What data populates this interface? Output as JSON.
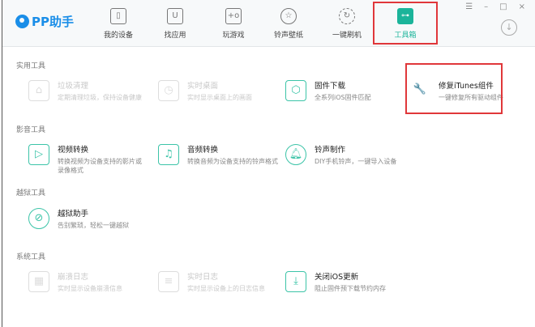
{
  "app": {
    "name": "PP助手"
  },
  "nav": [
    {
      "label": "我的设备",
      "icon": "phone-icon"
    },
    {
      "label": "找应用",
      "icon": "app-bag-icon"
    },
    {
      "label": "玩游戏",
      "icon": "gamepad-icon"
    },
    {
      "label": "铃声壁纸",
      "icon": "star-icon"
    },
    {
      "label": "一键刷机",
      "icon": "refresh-icon"
    },
    {
      "label": "工具箱",
      "icon": "toolbox-icon",
      "active": true
    }
  ],
  "window": {
    "menu": "☰",
    "minimize": "–",
    "maximize": "□",
    "close": "×",
    "download": "↓"
  },
  "sections": {
    "practical": "实用工具",
    "media": "影音工具",
    "jailbreak": "越狱工具",
    "system": "系统工具"
  },
  "tools": {
    "junk": {
      "title": "垃圾清理",
      "desc": "定期清理垃圾，保持设备健康"
    },
    "desktop": {
      "title": "实时桌面",
      "desc": "实时显示桌面上的画面"
    },
    "firmware": {
      "title": "固件下载",
      "desc": "全系列iOS固件匹配"
    },
    "itunes": {
      "title": "修复iTunes组件",
      "desc": "一键修复所有驱动组件"
    },
    "video": {
      "title": "视频转换",
      "desc": "转换视频为设备支持的影片或录像格式"
    },
    "audio": {
      "title": "音频转换",
      "desc": "转换音频为设备支持的铃声格式"
    },
    "ringtone": {
      "title": "铃声制作",
      "desc": "DIY手机铃声，一键导入设备"
    },
    "jb": {
      "title": "越狱助手",
      "desc": "告别繁琐，轻松一键越狱"
    },
    "crash": {
      "title": "崩溃日志",
      "desc": "实时显示设备崩溃信息"
    },
    "log": {
      "title": "实时日志",
      "desc": "实时显示设备上的日志信息"
    },
    "iosupdate": {
      "title": "关闭iOS更新",
      "desc": "阻止固件预下载节约内存"
    }
  },
  "colors": {
    "accent": "#1bb49a",
    "highlight": "#e0373a",
    "brand": "#1a8ee8"
  }
}
